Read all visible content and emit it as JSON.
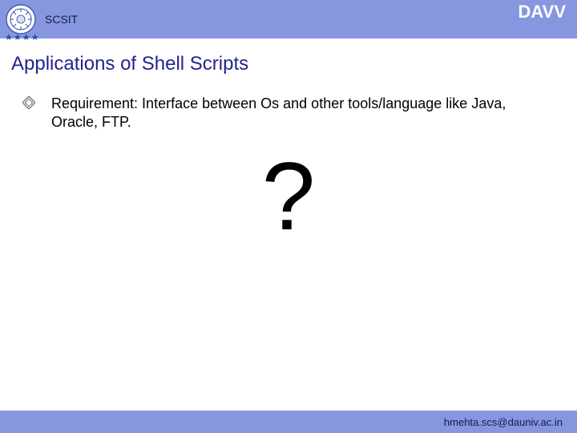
{
  "header": {
    "left_label": "SCSIT",
    "right_label": "DAVV"
  },
  "title": "Applications of Shell Scripts",
  "body": {
    "bullet1": "Requirement: Interface between Os and other tools/language like Java, Oracle, FTP.",
    "center_mark": "?"
  },
  "footer": {
    "email": "hmehta.scs@dauniv.ac.in"
  }
}
